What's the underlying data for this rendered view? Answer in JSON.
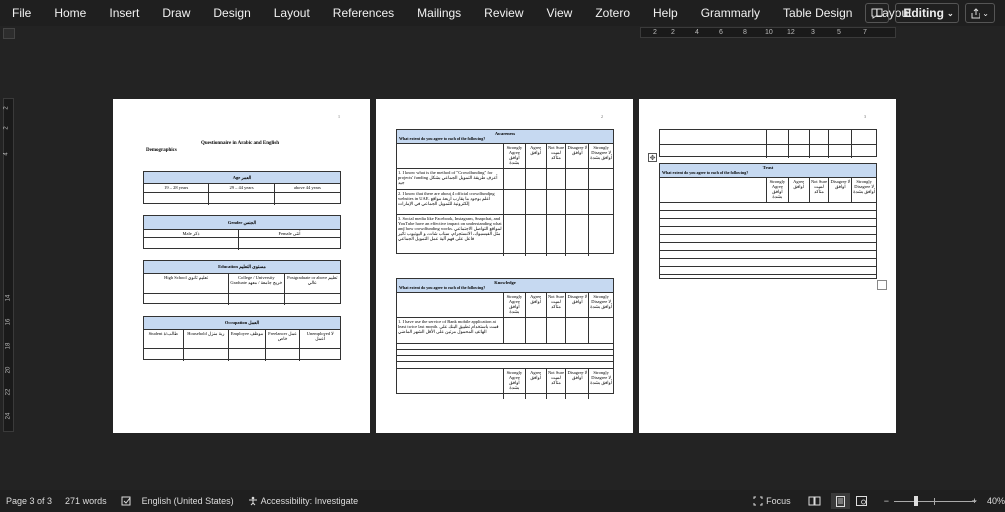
{
  "menubar": {
    "items": [
      "File",
      "Home",
      "Insert",
      "Draw",
      "Design",
      "Layout",
      "References",
      "Mailings",
      "Review",
      "View",
      "Zotero",
      "Help",
      "Grammarly",
      "Table Design",
      "Layout"
    ],
    "editing_label": "Editing"
  },
  "ruler": {
    "h_ticks": [
      "2",
      "2",
      "4",
      "6",
      "8",
      "10",
      "12",
      "3",
      "5",
      "7"
    ],
    "v_ticks": [
      "2",
      "2",
      "4",
      "14",
      "16",
      "18",
      "20",
      "22",
      "24"
    ]
  },
  "page1": {
    "num": "1",
    "title": "Questionnaire in Arabic and English",
    "section": "Demographics",
    "age": {
      "header": "Age العمر",
      "cells": [
        "19 – 28 years",
        "29 – 44 years",
        "above 44 years"
      ]
    },
    "gender": {
      "header": "Gender الجنس",
      "cells": [
        "Male ذكر",
        "Female أنثى"
      ]
    },
    "education": {
      "header": "Education مستوى التعليم",
      "cells": [
        "High School تعليم ثانوي",
        "College / University Graduate خريج جامعة / معهد",
        "Postgraduate or above تعليم عالي"
      ]
    },
    "occupation": {
      "header": "Occupation العمل",
      "cells": [
        "Student طالب/ة",
        "Household ربة منزل",
        "Employee موظف",
        "Freelancer عمل خاص",
        "Unemployed لا أعمل"
      ]
    }
  },
  "scale": [
    "Strongly Agree أوافق بشدة",
    "Agree أوافق",
    "Not Sure لست متأكد",
    "Disagree لا أوافق",
    "Strongly Disagree لا أوافق بشدة"
  ],
  "page2": {
    "num": "2",
    "awareness": {
      "title": "Awareness",
      "question": "What extent do you agree to each of the following?",
      "items": [
        "1. I know what is the method of \"Crowdfunding\" for projects' funding أعرف طريقة التمويل الجماعي بشكل جيد",
        "2. I know that there are about 4 official crowdfunding websites in UAE. أعلم بوجود ما يقارب أربعة مواقع إلكترونية للتمويل الجماعي في الإمارات",
        "3. Social media like Facebook, Instagram, Snapchat, and YouTube have an effective impact on understanding what and how crowdfunding works. لمواقع التواصل الاجتماعي مثل الفيسبوك، الانستجرام، سناب شات، و اليوتيوب تأثير فاعل على فهم آلية عمل التمويل الجماعي"
      ]
    },
    "knowledge": {
      "title": "Knowledge",
      "question": "What extent do you agree to each of the following?",
      "items": [
        "1. I have use the service of Bank mobile application at least twice last month. قمت باستخدام تطبيق البنك على الهاتف المحمول مرتين على الأقل الشهر الماضي"
      ]
    }
  },
  "page3": {
    "num": "3",
    "trust": {
      "title": "Trust",
      "question": "What extent do you agree to each of the following?"
    }
  },
  "status": {
    "page": "Page 3 of 3",
    "words": "271 words",
    "language": "English (United States)",
    "accessibility": "Accessibility: Investigate",
    "focus": "Focus",
    "zoom": "40%"
  }
}
